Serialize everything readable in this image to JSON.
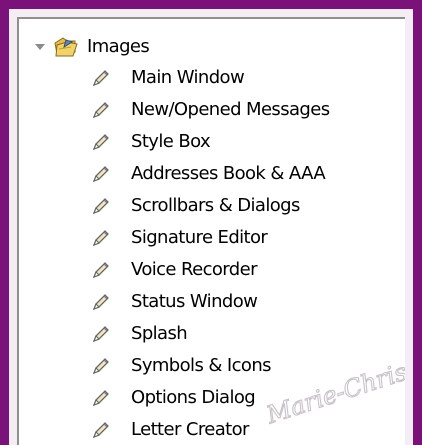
{
  "tree": {
    "root": {
      "label": "Images",
      "expander_icon": "triangle-down-icon",
      "icon": "folder-open-icon"
    },
    "items": [
      {
        "label": "Main Window",
        "icon": "pencil-icon"
      },
      {
        "label": "New/Opened Messages",
        "icon": "pencil-icon"
      },
      {
        "label": "Style Box",
        "icon": "pencil-icon"
      },
      {
        "label": "Addresses Book & AAA",
        "icon": "pencil-icon"
      },
      {
        "label": "Scrollbars & Dialogs",
        "icon": "pencil-icon"
      },
      {
        "label": "Signature Editor",
        "icon": "pencil-icon"
      },
      {
        "label": "Voice Recorder",
        "icon": "pencil-icon"
      },
      {
        "label": "Status Window",
        "icon": "pencil-icon"
      },
      {
        "label": "Splash",
        "icon": "pencil-icon"
      },
      {
        "label": "Symbols & Icons",
        "icon": "pencil-icon"
      },
      {
        "label": "Options Dialog",
        "icon": "pencil-icon"
      },
      {
        "label": "Letter Creator",
        "icon": "pencil-icon"
      }
    ]
  },
  "colors": {
    "frame_purple": "#7a127a",
    "panel_background": "#ffffff",
    "frame_inner": "#f4eef4"
  },
  "signature_text": "Marie-Christine"
}
